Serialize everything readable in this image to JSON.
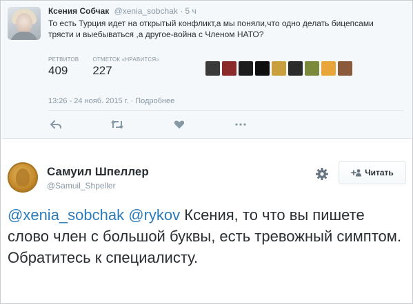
{
  "tweet1": {
    "author_name": "Ксения Собчак",
    "author_handle": "@xenia_sobchak",
    "time": "· 5 ч",
    "text": "То есть Турция идет на открытый конфликт,а мы поняли,что одно делать бицепсами трясти и выебываться ,а другое-война с Членом НАТО?",
    "retweets_label": "РЕТВИТОВ",
    "retweets_value": "409",
    "likes_label": "ОТМЕТОК «НРАВИТСЯ»",
    "likes_value": "227",
    "date": "13:26 - 24 нояб. 2015 г. · Подробнее",
    "liker_colors": [
      "#3a3a3a",
      "#8b2a2a",
      "#1d1d1d",
      "#0f0f0f",
      "#c9a03d",
      "#2b2b2b",
      "#7a8a3a",
      "#e8a63a",
      "#8a5a3a"
    ],
    "actions": [
      "reply-icon",
      "retweet-icon",
      "like-icon",
      "more-icon"
    ]
  },
  "tweet2": {
    "author_name": "Самуил Шпеллер",
    "author_handle": "@Samuil_Shpeller",
    "follow_label": "Читать",
    "mention1": "@xenia_sobchak",
    "mention2": "@rykov",
    "text": " Ксения, то что вы пишете слово член с большой буквы, есть тревожный симптом. Обратитесь к специалисту."
  },
  "colors": {
    "link": "#2b7bb9",
    "muted": "#8899a6",
    "text": "#292f33",
    "card_bg": "#f5f8fa"
  }
}
